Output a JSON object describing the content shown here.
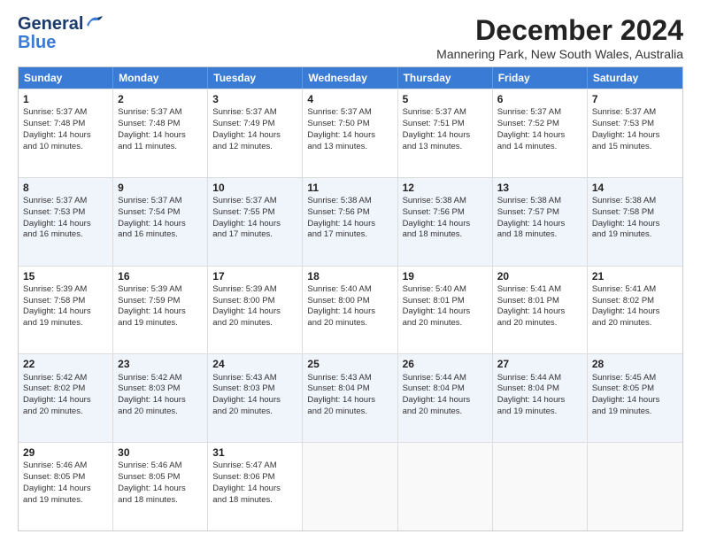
{
  "header": {
    "logo_general": "General",
    "logo_blue": "Blue",
    "title": "December 2024",
    "subtitle": "Mannering Park, New South Wales, Australia"
  },
  "weekdays": [
    "Sunday",
    "Monday",
    "Tuesday",
    "Wednesday",
    "Thursday",
    "Friday",
    "Saturday"
  ],
  "rows": [
    {
      "alt": false,
      "cells": [
        {
          "day": 1,
          "lines": [
            "Sunrise: 5:37 AM",
            "Sunset: 7:48 PM",
            "Daylight: 14 hours",
            "and 10 minutes."
          ]
        },
        {
          "day": 2,
          "lines": [
            "Sunrise: 5:37 AM",
            "Sunset: 7:48 PM",
            "Daylight: 14 hours",
            "and 11 minutes."
          ]
        },
        {
          "day": 3,
          "lines": [
            "Sunrise: 5:37 AM",
            "Sunset: 7:49 PM",
            "Daylight: 14 hours",
            "and 12 minutes."
          ]
        },
        {
          "day": 4,
          "lines": [
            "Sunrise: 5:37 AM",
            "Sunset: 7:50 PM",
            "Daylight: 14 hours",
            "and 13 minutes."
          ]
        },
        {
          "day": 5,
          "lines": [
            "Sunrise: 5:37 AM",
            "Sunset: 7:51 PM",
            "Daylight: 14 hours",
            "and 13 minutes."
          ]
        },
        {
          "day": 6,
          "lines": [
            "Sunrise: 5:37 AM",
            "Sunset: 7:52 PM",
            "Daylight: 14 hours",
            "and 14 minutes."
          ]
        },
        {
          "day": 7,
          "lines": [
            "Sunrise: 5:37 AM",
            "Sunset: 7:53 PM",
            "Daylight: 14 hours",
            "and 15 minutes."
          ]
        }
      ]
    },
    {
      "alt": true,
      "cells": [
        {
          "day": 8,
          "lines": [
            "Sunrise: 5:37 AM",
            "Sunset: 7:53 PM",
            "Daylight: 14 hours",
            "and 16 minutes."
          ]
        },
        {
          "day": 9,
          "lines": [
            "Sunrise: 5:37 AM",
            "Sunset: 7:54 PM",
            "Daylight: 14 hours",
            "and 16 minutes."
          ]
        },
        {
          "day": 10,
          "lines": [
            "Sunrise: 5:37 AM",
            "Sunset: 7:55 PM",
            "Daylight: 14 hours",
            "and 17 minutes."
          ]
        },
        {
          "day": 11,
          "lines": [
            "Sunrise: 5:38 AM",
            "Sunset: 7:56 PM",
            "Daylight: 14 hours",
            "and 17 minutes."
          ]
        },
        {
          "day": 12,
          "lines": [
            "Sunrise: 5:38 AM",
            "Sunset: 7:56 PM",
            "Daylight: 14 hours",
            "and 18 minutes."
          ]
        },
        {
          "day": 13,
          "lines": [
            "Sunrise: 5:38 AM",
            "Sunset: 7:57 PM",
            "Daylight: 14 hours",
            "and 18 minutes."
          ]
        },
        {
          "day": 14,
          "lines": [
            "Sunrise: 5:38 AM",
            "Sunset: 7:58 PM",
            "Daylight: 14 hours",
            "and 19 minutes."
          ]
        }
      ]
    },
    {
      "alt": false,
      "cells": [
        {
          "day": 15,
          "lines": [
            "Sunrise: 5:39 AM",
            "Sunset: 7:58 PM",
            "Daylight: 14 hours",
            "and 19 minutes."
          ]
        },
        {
          "day": 16,
          "lines": [
            "Sunrise: 5:39 AM",
            "Sunset: 7:59 PM",
            "Daylight: 14 hours",
            "and 19 minutes."
          ]
        },
        {
          "day": 17,
          "lines": [
            "Sunrise: 5:39 AM",
            "Sunset: 8:00 PM",
            "Daylight: 14 hours",
            "and 20 minutes."
          ]
        },
        {
          "day": 18,
          "lines": [
            "Sunrise: 5:40 AM",
            "Sunset: 8:00 PM",
            "Daylight: 14 hours",
            "and 20 minutes."
          ]
        },
        {
          "day": 19,
          "lines": [
            "Sunrise: 5:40 AM",
            "Sunset: 8:01 PM",
            "Daylight: 14 hours",
            "and 20 minutes."
          ]
        },
        {
          "day": 20,
          "lines": [
            "Sunrise: 5:41 AM",
            "Sunset: 8:01 PM",
            "Daylight: 14 hours",
            "and 20 minutes."
          ]
        },
        {
          "day": 21,
          "lines": [
            "Sunrise: 5:41 AM",
            "Sunset: 8:02 PM",
            "Daylight: 14 hours",
            "and 20 minutes."
          ]
        }
      ]
    },
    {
      "alt": true,
      "cells": [
        {
          "day": 22,
          "lines": [
            "Sunrise: 5:42 AM",
            "Sunset: 8:02 PM",
            "Daylight: 14 hours",
            "and 20 minutes."
          ]
        },
        {
          "day": 23,
          "lines": [
            "Sunrise: 5:42 AM",
            "Sunset: 8:03 PM",
            "Daylight: 14 hours",
            "and 20 minutes."
          ]
        },
        {
          "day": 24,
          "lines": [
            "Sunrise: 5:43 AM",
            "Sunset: 8:03 PM",
            "Daylight: 14 hours",
            "and 20 minutes."
          ]
        },
        {
          "day": 25,
          "lines": [
            "Sunrise: 5:43 AM",
            "Sunset: 8:04 PM",
            "Daylight: 14 hours",
            "and 20 minutes."
          ]
        },
        {
          "day": 26,
          "lines": [
            "Sunrise: 5:44 AM",
            "Sunset: 8:04 PM",
            "Daylight: 14 hours",
            "and 20 minutes."
          ]
        },
        {
          "day": 27,
          "lines": [
            "Sunrise: 5:44 AM",
            "Sunset: 8:04 PM",
            "Daylight: 14 hours",
            "and 19 minutes."
          ]
        },
        {
          "day": 28,
          "lines": [
            "Sunrise: 5:45 AM",
            "Sunset: 8:05 PM",
            "Daylight: 14 hours",
            "and 19 minutes."
          ]
        }
      ]
    },
    {
      "alt": false,
      "cells": [
        {
          "day": 29,
          "lines": [
            "Sunrise: 5:46 AM",
            "Sunset: 8:05 PM",
            "Daylight: 14 hours",
            "and 19 minutes."
          ]
        },
        {
          "day": 30,
          "lines": [
            "Sunrise: 5:46 AM",
            "Sunset: 8:05 PM",
            "Daylight: 14 hours",
            "and 18 minutes."
          ]
        },
        {
          "day": 31,
          "lines": [
            "Sunrise: 5:47 AM",
            "Sunset: 8:06 PM",
            "Daylight: 14 hours",
            "and 18 minutes."
          ]
        },
        {
          "day": null,
          "lines": []
        },
        {
          "day": null,
          "lines": []
        },
        {
          "day": null,
          "lines": []
        },
        {
          "day": null,
          "lines": []
        }
      ]
    }
  ]
}
